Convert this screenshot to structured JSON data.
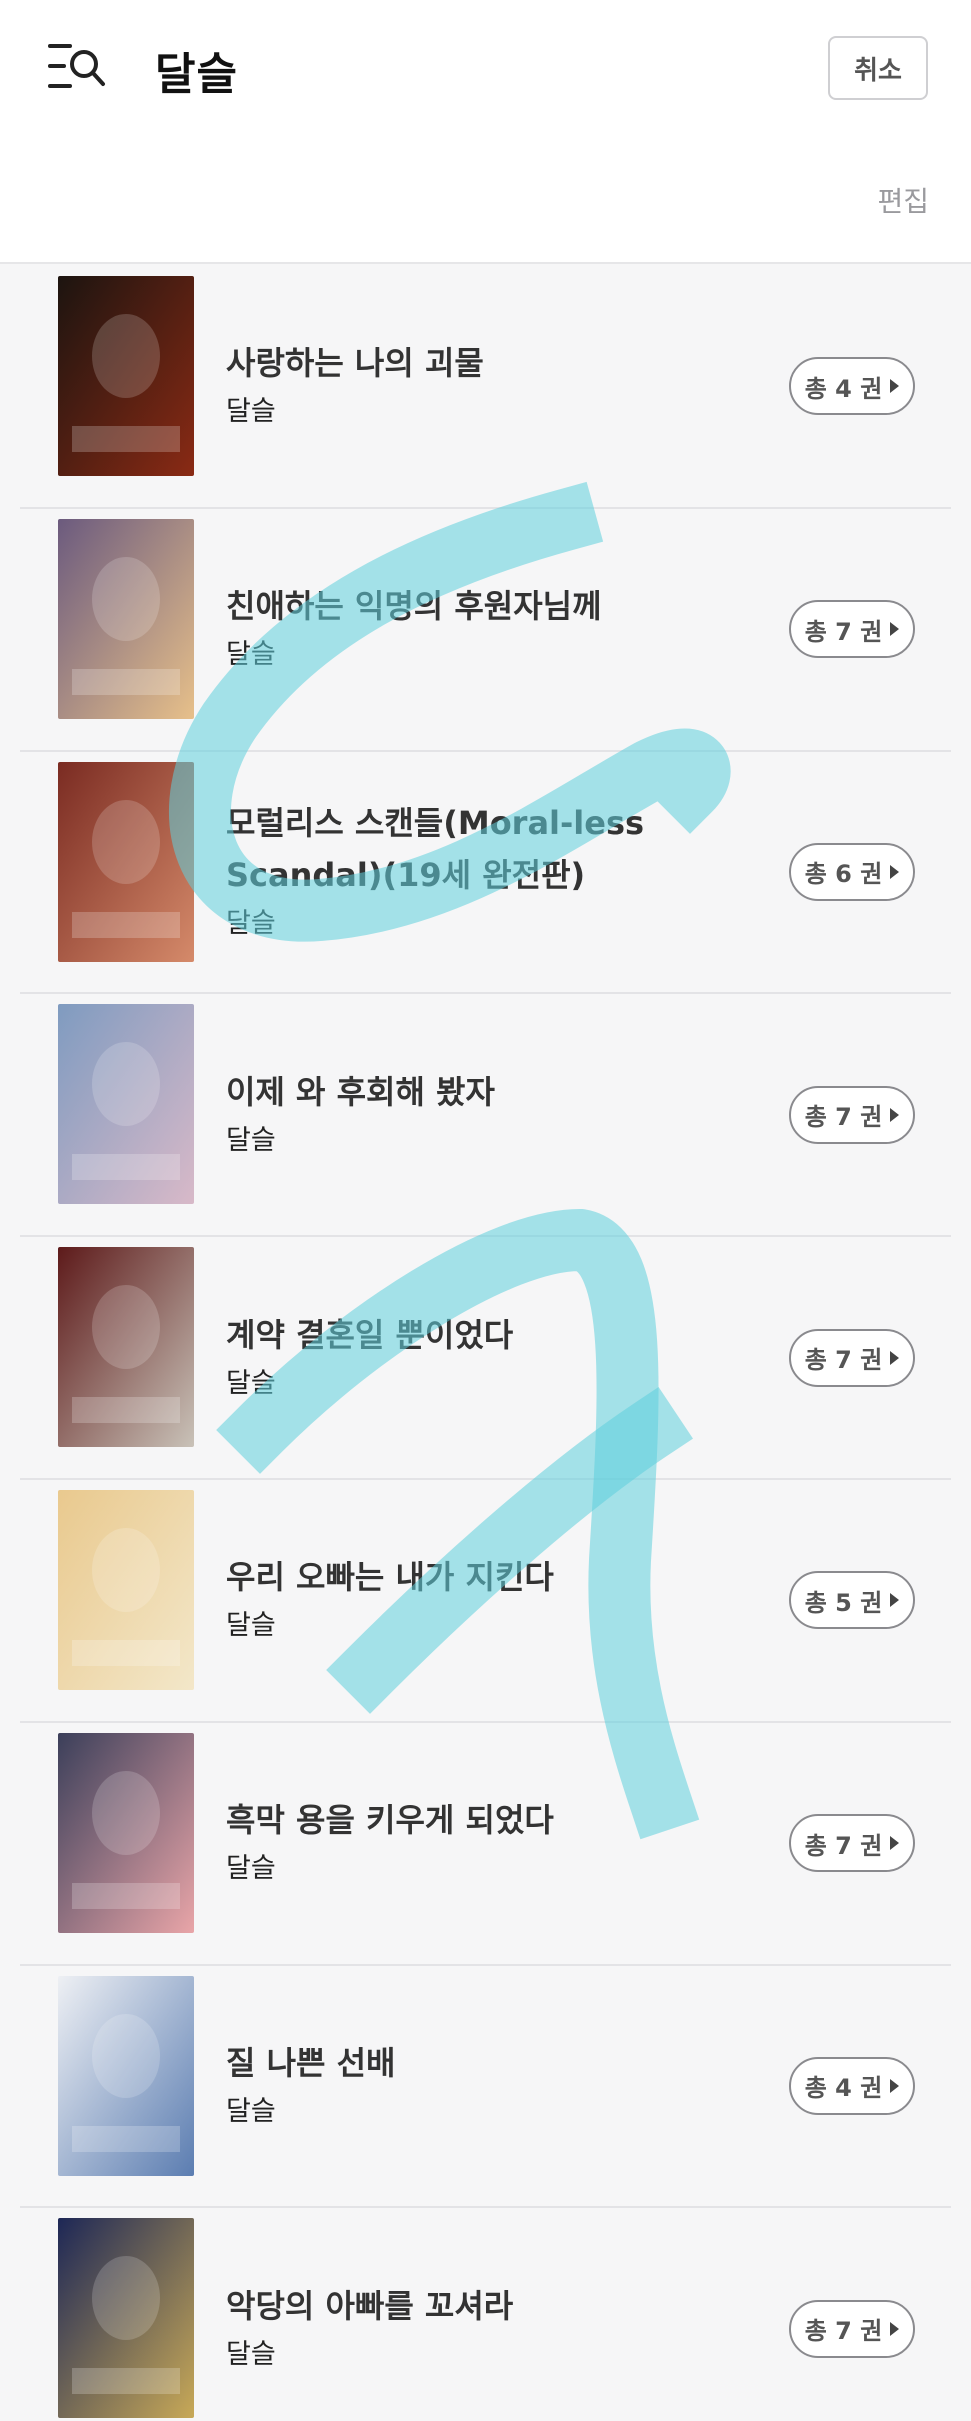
{
  "header": {
    "title": "달슬",
    "cancel_label": "취소",
    "edit_label": "편집"
  },
  "books": [
    {
      "title": "사랑하는 나의 괴물",
      "author": "달슬",
      "volumes": "총 4 권",
      "cover_colors": [
        "#1c1410",
        "#8a2a14"
      ]
    },
    {
      "title": "친애하는 익명의 후원자님께",
      "author": "달슬",
      "volumes": "총 7 권",
      "cover_colors": [
        "#6b5a7e",
        "#e7c08a"
      ]
    },
    {
      "title": "모럴리스 스캔들(Moral-less Scandal)(19세 완전판)",
      "author": "달슬",
      "volumes": "총 6 권",
      "cover_colors": [
        "#7a2b22",
        "#d58a6a"
      ]
    },
    {
      "title": "이제 와 후회해 봤자",
      "author": "달슬",
      "volumes": "총 7 권",
      "cover_colors": [
        "#7f9bc0",
        "#d8b9c8"
      ]
    },
    {
      "title": "계약 결혼일 뿐이었다",
      "author": "달슬",
      "volumes": "총 7 권",
      "cover_colors": [
        "#5d1a1a",
        "#c9c2b8"
      ]
    },
    {
      "title": "우리 오빠는 내가 지킨다",
      "author": "달슬",
      "volumes": "총 5 권",
      "cover_colors": [
        "#e9c98e",
        "#f3e7c9"
      ]
    },
    {
      "title": "흑막 용을 키우게 되었다",
      "author": "달슬",
      "volumes": "총 7 권",
      "cover_colors": [
        "#3b3f5a",
        "#e9a5a8"
      ]
    },
    {
      "title": "질 나쁜 선배",
      "author": "달슬",
      "volumes": "총 4 권",
      "cover_colors": [
        "#eef0f4",
        "#5b7db1"
      ]
    },
    {
      "title": "악당의 아빠를 꼬셔라",
      "author": "달슬",
      "volumes": "총 7 권",
      "cover_colors": [
        "#1d2756",
        "#c8a957"
      ]
    }
  ],
  "colors": {
    "accent_scribble": "#5fd0dc",
    "header_bg": "#ffffff",
    "page_bg": "#f6f6f7"
  }
}
